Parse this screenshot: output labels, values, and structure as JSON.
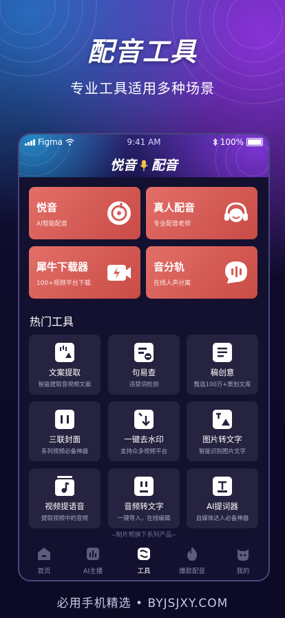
{
  "hero": {
    "title": "配音工具",
    "subtitle": "专业工具适用多种场景"
  },
  "status_bar": {
    "carrier": "Figma",
    "time": "9:41 AM",
    "battery": "100%"
  },
  "app": {
    "logo_left": "悦音",
    "logo_right": "配音"
  },
  "feature_cards": [
    {
      "title": "悦音",
      "subtitle": "AI智能配音",
      "icon": "disc-icon"
    },
    {
      "title": "真人配音",
      "subtitle": "专业配音老师",
      "icon": "headset-icon"
    },
    {
      "title": "犀牛下载器",
      "subtitle": "100+视频平台下载",
      "icon": "video-bolt-icon"
    },
    {
      "title": "音分轨",
      "subtitle": "在线人声分离",
      "icon": "voice-chat-icon"
    }
  ],
  "hot_tools": {
    "title": "热门工具",
    "items": [
      {
        "title": "文案提取",
        "subtitle": "智能提取音视频文案"
      },
      {
        "title": "句易查",
        "subtitle": "违禁词检测"
      },
      {
        "title": "稿创意",
        "subtitle": "甄选100万+策划文库"
      },
      {
        "title": "三联封面",
        "subtitle": "系列视频必备神器"
      },
      {
        "title": "一键去水印",
        "subtitle": "支持众多视频平台"
      },
      {
        "title": "图片转文字",
        "subtitle": "智能识别图片文字"
      },
      {
        "title": "视频提语音",
        "subtitle": "提取视频中的音频"
      },
      {
        "title": "音频转文字",
        "subtitle": "一键导入，在线编辑"
      },
      {
        "title": "AI提词器",
        "subtitle": "自媒体达人必备神器"
      }
    ]
  },
  "footer_note": "--制片帮旗下系列产品--",
  "tabbar": {
    "items": [
      {
        "label": "首页"
      },
      {
        "label": "AI主播"
      },
      {
        "label": "工具"
      },
      {
        "label": "爆款配音"
      },
      {
        "label": "我的"
      }
    ],
    "active": "工具"
  },
  "bottom_watermark": "必用手机精选 • BYJSJXY.COM",
  "colors": {
    "card_red": "#d85a54",
    "tool_bg": "#25233f",
    "page_bg": "#0e0c2c"
  }
}
